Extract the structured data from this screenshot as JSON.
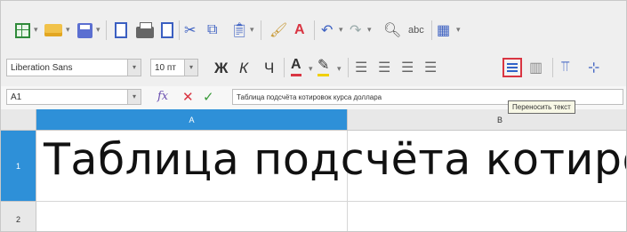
{
  "formatting": {
    "font_name": "Liberation Sans",
    "font_size": "10 пт",
    "bold": "Ж",
    "italic": "К",
    "underline": "Ч"
  },
  "formula_bar": {
    "cell_ref": "A1",
    "fx": "fx",
    "cancel": "✕",
    "accept": "✓",
    "content": "Таблица подсчёта котировок курса доллара"
  },
  "tooltip": "Переносить текст",
  "grid": {
    "columns": [
      "A",
      "B"
    ],
    "rows": [
      "1",
      "2"
    ],
    "cell_a1": "Таблица подсчёта котиро"
  },
  "colors": {
    "selection": "#2e90d8",
    "highlight_border": "#d93542"
  }
}
